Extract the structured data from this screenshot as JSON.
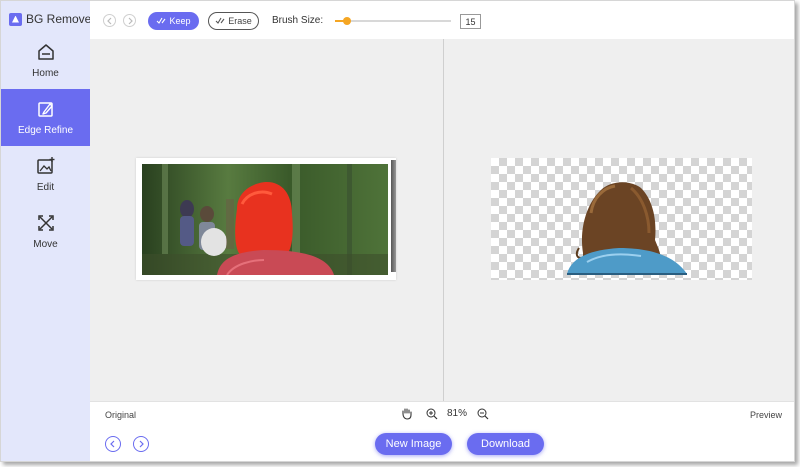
{
  "app": {
    "title": "BG Remover",
    "accent_color": "#6a6cf0"
  },
  "sidebar": {
    "items": [
      {
        "label": "Home",
        "icon": "home-icon",
        "active": false
      },
      {
        "label": "Edge Refine",
        "icon": "edge-refine-icon",
        "active": true
      },
      {
        "label": "Edit",
        "icon": "edit-image-icon",
        "active": false
      },
      {
        "label": "Move",
        "icon": "move-icon",
        "active": false
      }
    ]
  },
  "toolbar": {
    "undo_icon": "undo-icon",
    "redo_icon": "redo-icon",
    "keep_label": "Keep",
    "erase_label": "Erase",
    "brush_size_label": "Brush Size:",
    "brush_size_value": "15",
    "brush_slider_fraction": 0.1,
    "slider_color": "#f5a623"
  },
  "canvas": {
    "original_label": "Original",
    "preview_label": "Preview"
  },
  "zoom": {
    "level": "81%"
  },
  "footer": {
    "prev_icon": "chevron-left-icon",
    "next_icon": "chevron-right-icon",
    "new_image_label": "New Image",
    "download_label": "Download"
  }
}
